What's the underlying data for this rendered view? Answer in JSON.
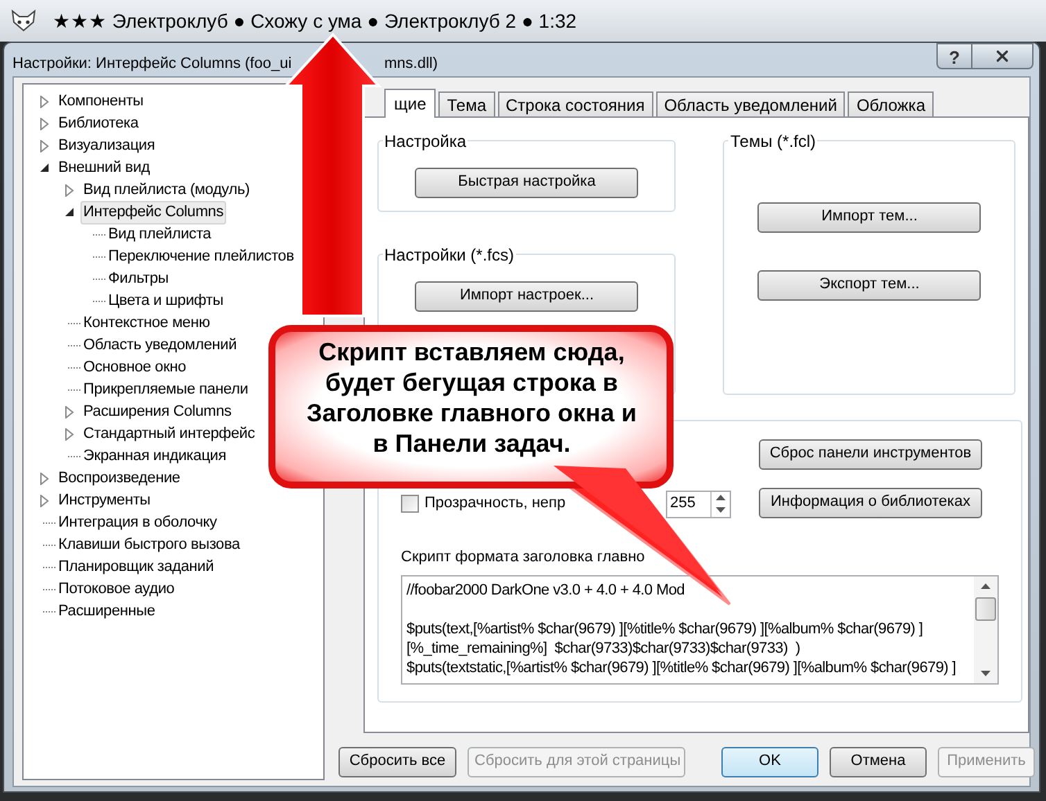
{
  "main_window": {
    "title": "★★★ Электроклуб ● Схожу с ума ● Электроклуб 2 ● 1:32"
  },
  "dialog": {
    "title_left": "Настройки: Интерфейс Columns (foo_ui",
    "title_right": "mns.dll)",
    "help_button": "?"
  },
  "tree": [
    {
      "label": "Компоненты",
      "expanded": false,
      "selected": false
    },
    {
      "label": "Библиотека",
      "expanded": false,
      "selected": false
    },
    {
      "label": "Визуализация",
      "expanded": false,
      "selected": false
    },
    {
      "label": "Внешний вид",
      "expanded": true,
      "selected": false,
      "children": [
        {
          "label": "Вид плейлиста (модуль)",
          "expanded": false,
          "selected": false
        },
        {
          "label": "Интерфейс Columns",
          "expanded": true,
          "selected": true,
          "children": [
            {
              "label": "Вид плейлиста",
              "selected": false
            },
            {
              "label": "Переключение плейлистов",
              "selected": false
            },
            {
              "label": "Фильтры",
              "selected": false
            },
            {
              "label": "Цвета и шрифты",
              "selected": false
            }
          ]
        },
        {
          "label": "Контекстное меню",
          "selected": false
        },
        {
          "label": "Область уведомлений",
          "selected": false
        },
        {
          "label": "Основное окно",
          "selected": false
        },
        {
          "label": "Прикрепляемые панели",
          "selected": false
        },
        {
          "label": "Расширения Columns",
          "expanded": false,
          "selected": false
        },
        {
          "label": "Стандартный интерфейс",
          "expanded": false,
          "selected": false
        },
        {
          "label": "Экранная индикация",
          "selected": false
        }
      ]
    },
    {
      "label": "Воспроизведение",
      "expanded": false,
      "selected": false
    },
    {
      "label": "Инструменты",
      "expanded": false,
      "selected": false
    },
    {
      "label": "Интеграция в оболочку",
      "selected": false
    },
    {
      "label": "Клавиши быстрого вызова",
      "selected": false
    },
    {
      "label": "Планировщик заданий",
      "selected": false
    },
    {
      "label": "Потоковое аудио",
      "selected": false
    },
    {
      "label": "Расширенные",
      "selected": false
    }
  ],
  "tabs": [
    {
      "label": "щие",
      "selected": true
    },
    {
      "label": "Тема",
      "selected": false
    },
    {
      "label": "Строка состояния",
      "selected": false
    },
    {
      "label": "Область уведомлений",
      "selected": false
    },
    {
      "label": "Обложка",
      "selected": false
    }
  ],
  "setup_group": {
    "title": "Настройка",
    "button": "Быстрая настройка"
  },
  "settings_group": {
    "title": "Настройки (*.fcs)",
    "button": "Импорт настроек..."
  },
  "themes_group": {
    "title": "Темы (*.fcl)",
    "buttons": [
      "Импорт тем...",
      "Экспорт тем..."
    ]
  },
  "misc_group": {
    "buttons": [
      "Сброс панели инструментов",
      "Информация о библиотеках"
    ],
    "transparency": {
      "label": "Прозрачность, непр",
      "checked": false,
      "value": "255"
    },
    "script_label": "Скрипт формата заголовка главно",
    "script_paragraphs": [
      [
        "//foobar2000 DarkOne v3.0 + 4.0 + 4.0 Mod"
      ],
      [
        "$puts(text,[%artist% $char(9679) ][%title% $char(9679) ][%album% $char(9679) ]",
        "[%_time_remaining%]  $char(9733)$char(9733)$char(9733)  )",
        "$puts(textstatic,[%artist% $char(9679) ][%title% $char(9679) ][%album% $char(9679) ]"
      ]
    ]
  },
  "footer_buttons": [
    {
      "label": "Сбросить все",
      "disabled": false,
      "default": false
    },
    {
      "label": "Сбросить для этой страницы",
      "disabled": true,
      "default": false
    },
    {
      "label": "OK",
      "disabled": false,
      "default": true
    },
    {
      "label": "Отмена",
      "disabled": false,
      "default": false
    },
    {
      "label": "Применить",
      "disabled": true,
      "default": false
    }
  ],
  "callout": {
    "lines": [
      "Скрипт вставляем сюда,",
      "будет бегущая строка в",
      "Заголовке главного окна и",
      "в Панели задач."
    ]
  }
}
